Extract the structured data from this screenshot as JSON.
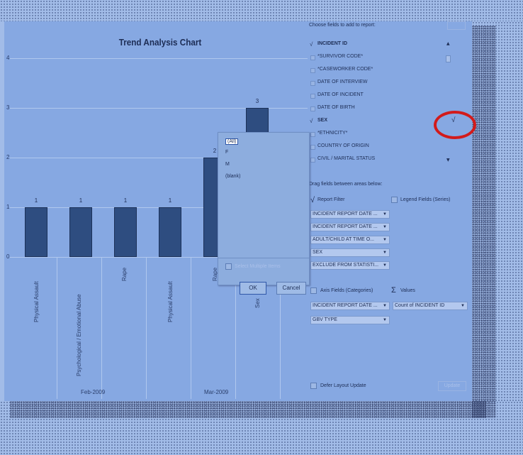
{
  "chart": {
    "title": "Trend Analysis Chart",
    "y_ticks": [
      "4",
      "3",
      "2",
      "1",
      "0"
    ],
    "bar_labels": [
      "1",
      "1",
      "1",
      "1",
      "2",
      "3"
    ],
    "categories": [
      "Physical Assault",
      "Psychological / Emotional Abuse",
      "Rape",
      "Physical Assault",
      "Rape",
      "Sex"
    ],
    "groups": [
      "Feb-2009",
      "Mar-2009"
    ]
  },
  "chart_data": {
    "type": "bar",
    "title": "Trend Analysis Chart",
    "categories": [
      "Physical Assault",
      "Psychological / Emotional Abuse",
      "Rape",
      "Physical Assault",
      "Rape",
      "Sex"
    ],
    "groups": [
      {
        "name": "Feb-2009",
        "categories": [
          "Physical Assault",
          "Psychological / Emotional Abuse",
          "Rape",
          "Physical Assault"
        ]
      },
      {
        "name": "Mar-2009",
        "categories": [
          "Rape",
          "Sex"
        ]
      }
    ],
    "values": [
      1,
      1,
      1,
      1,
      2,
      3
    ],
    "ylim": [
      0,
      4
    ],
    "grid": true
  },
  "filter_popup": {
    "items": [
      "(All)",
      "F",
      "M",
      "(blank)"
    ],
    "select_multiple_label": "Select Multiple Items",
    "ok_label": "OK",
    "cancel_label": "Cancel"
  },
  "field_list": {
    "choose_header": "Choose fields to add to report:",
    "fields": [
      {
        "label": "INCIDENT ID",
        "checked": true,
        "bold": true
      },
      {
        "label": "*SURVIVOR CODE*",
        "checked": false,
        "bold": false
      },
      {
        "label": "*CASEWORKER CODE*",
        "checked": false,
        "bold": false
      },
      {
        "label": "DATE OF INTERVIEW",
        "checked": false,
        "bold": false
      },
      {
        "label": "DATE OF INCIDENT",
        "checked": false,
        "bold": false
      },
      {
        "label": "DATE OF BIRTH",
        "checked": false,
        "bold": false
      },
      {
        "label": "SEX",
        "checked": true,
        "bold": true
      },
      {
        "label": "*ETHNICITY*",
        "checked": false,
        "bold": false
      },
      {
        "label": "COUNTRY OF ORIGIN",
        "checked": false,
        "bold": false
      },
      {
        "label": "CIVIL / MARITAL STATUS",
        "checked": false,
        "bold": false
      }
    ],
    "drag_header": "Drag fields between areas below:",
    "report_filter_label": "Report Filter",
    "legend_fields_label": "Legend Fields (Series)",
    "report_filters": [
      "INCIDENT REPORT DATE ...",
      "INCIDENT REPORT DATE ...",
      "ADULT/CHILD AT TIME O...",
      "SEX",
      "EXCLUDE FROM STATISTI..."
    ],
    "axis_fields_label": "Axis Fields (Categories)",
    "values_label": "Values",
    "sigma": "Σ",
    "axis_fields": [
      "INCIDENT REPORT DATE ...",
      "GBV TYPE"
    ],
    "values_fields": [
      "Count of INCIDENT ID"
    ],
    "defer_label": "Defer Layout Update",
    "update_label": "Update"
  },
  "colors": {
    "bar": "#2e4d80",
    "annotation": "#d21b1b",
    "background": "#a2bce8"
  }
}
